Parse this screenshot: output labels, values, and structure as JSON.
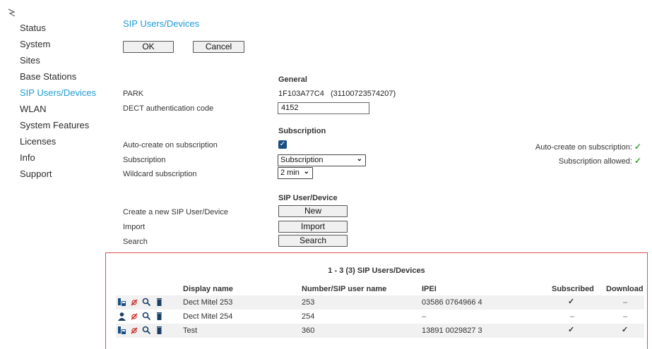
{
  "sidebar": {
    "items": [
      {
        "label": "Status",
        "active": false
      },
      {
        "label": "System",
        "active": false
      },
      {
        "label": "Sites",
        "active": false
      },
      {
        "label": "Base Stations",
        "active": false
      },
      {
        "label": "SIP Users/Devices",
        "active": true
      },
      {
        "label": "WLAN",
        "active": false
      },
      {
        "label": "System Features",
        "active": false
      },
      {
        "label": "Licenses",
        "active": false
      },
      {
        "label": "Info",
        "active": false
      },
      {
        "label": "Support",
        "active": false
      }
    ]
  },
  "page": {
    "title": "SIP Users/Devices",
    "ok_label": "OK",
    "cancel_label": "Cancel"
  },
  "general": {
    "heading": "General",
    "park_label": "PARK",
    "park_value": "1F103A77C4",
    "park_number": "(31100723574207)",
    "dect_auth_label": "DECT authentication code",
    "dect_auth_value": "4152"
  },
  "subscription": {
    "heading": "Subscription",
    "auto_create_label": "Auto-create on subscription",
    "auto_create_checked": true,
    "subscription_label": "Subscription",
    "subscription_value": "Subscription",
    "wildcard_label": "Wildcard subscription",
    "wildcard_value": "2 min",
    "status_auto_create": "Auto-create on subscription:",
    "status_allowed": "Subscription allowed:"
  },
  "sip_section": {
    "heading": "SIP User/Device",
    "create_label": "Create a new SIP User/Device",
    "create_button": "New",
    "import_label": "Import",
    "import_button": "Import",
    "search_label": "Search",
    "search_button": "Search"
  },
  "results": {
    "title": "1 - 3 (3) SIP Users/Devices",
    "columns": {
      "display_name": "Display name",
      "number": "Number/SIP user name",
      "ipei": "IPEI",
      "subscribed": "Subscribed",
      "download": "Download"
    },
    "rows": [
      {
        "display_name": "Dect Mitel 253",
        "number": "253",
        "ipei": "03586 0764966 4",
        "subscribed": "✓",
        "download": "–",
        "type_icon": "dect-device-icon"
      },
      {
        "display_name": "Dect Mitel 254",
        "number": "254",
        "ipei": "–",
        "subscribed": "–",
        "download": "–",
        "type_icon": "user-icon"
      },
      {
        "display_name": "Test",
        "number": "360",
        "ipei": "13891 0029827 3",
        "subscribed": "✓",
        "download": "✓",
        "type_icon": "dect-device-icon"
      }
    ]
  },
  "colors": {
    "accent": "#1e9bd7",
    "success": "#3aa537",
    "panel_border": "#d9534f"
  }
}
